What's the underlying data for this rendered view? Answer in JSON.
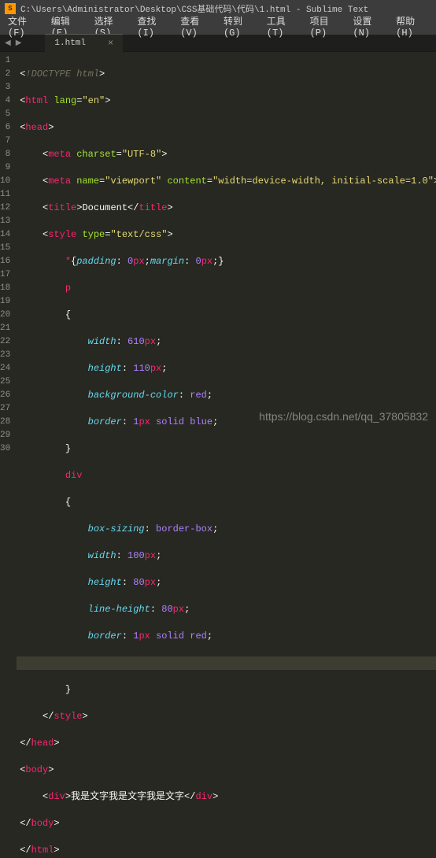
{
  "titlebar": {
    "path": "C:\\Users\\Administrator\\Desktop\\CSS基础代码\\代码\\1.html - Sublime Text"
  },
  "menu": {
    "file": "文件(F)",
    "edit": "编辑(E)",
    "select": "选择(S)",
    "find": "查找(I)",
    "view": "查看(V)",
    "goto": "转到(G)",
    "tools": "工具(T)",
    "project": "项目(P)",
    "settings": "设置(N)",
    "help": "帮助(H)"
  },
  "tab": {
    "name": "1.html"
  },
  "lines": [
    "1",
    "2",
    "3",
    "4",
    "5",
    "6",
    "7",
    "8",
    "9",
    "10",
    "11",
    "12",
    "13",
    "14",
    "15",
    "16",
    "17",
    "18",
    "19",
    "20",
    "21",
    "22",
    "23",
    "24",
    "25",
    "26",
    "27",
    "28",
    "29",
    "30"
  ],
  "code": {
    "l1": {
      "doctype": "!DOCTYPE",
      "html": "html"
    },
    "l2": {
      "tag": "html",
      "attr": "lang",
      "val": "\"en\""
    },
    "l3": {
      "tag": "head"
    },
    "l4": {
      "tag": "meta",
      "attr": "charset",
      "val": "\"UTF-8\""
    },
    "l5": {
      "tag": "meta",
      "a1": "name",
      "v1": "\"viewport\"",
      "a2": "content",
      "v2": "\"width=device-width, initial-scale=1.0\""
    },
    "l6": {
      "tag": "title",
      "text": "Document",
      "close": "title"
    },
    "l7": {
      "tag": "style",
      "attr": "type",
      "val": "\"text/css\""
    },
    "l8": {
      "sel": "*",
      "p1": "padding",
      "v1": "0",
      "u1": "px",
      "p2": "margin",
      "v2": "0",
      "u2": "px"
    },
    "l9": {
      "sel": "p"
    },
    "l10": {
      "brace": "{"
    },
    "l11": {
      "prop": "width",
      "val": "610",
      "unit": "px"
    },
    "l12": {
      "prop": "height",
      "val": "110",
      "unit": "px"
    },
    "l13": {
      "prop": "background-color",
      "val": "red"
    },
    "l14": {
      "prop": "border",
      "v1": "1",
      "u1": "px",
      "v2": "solid",
      "v3": "blue"
    },
    "l15": {
      "brace": "}"
    },
    "l16": {
      "sel": "div"
    },
    "l17": {
      "brace": "{"
    },
    "l18": {
      "prop": "box-sizing",
      "val": "border-box"
    },
    "l19": {
      "prop": "width",
      "val": "100",
      "unit": "px"
    },
    "l20": {
      "prop": "height",
      "val": "80",
      "unit": "px"
    },
    "l21": {
      "prop": "line-height",
      "val": "80",
      "unit": "px"
    },
    "l22": {
      "prop": "border",
      "v1": "1",
      "u1": "px",
      "v2": "solid",
      "v3": "red"
    },
    "l24": {
      "brace": "}"
    },
    "l25": {
      "tag": "style"
    },
    "l26": {
      "tag": "head"
    },
    "l27": {
      "tag": "body"
    },
    "l28": {
      "tag": "div",
      "text": "我是文字我是文字我是文字",
      "close": "div"
    },
    "l29": {
      "tag": "body"
    },
    "l30": {
      "tag": "html"
    }
  },
  "watermark": "https://blog.csdn.net/qq_37805832"
}
